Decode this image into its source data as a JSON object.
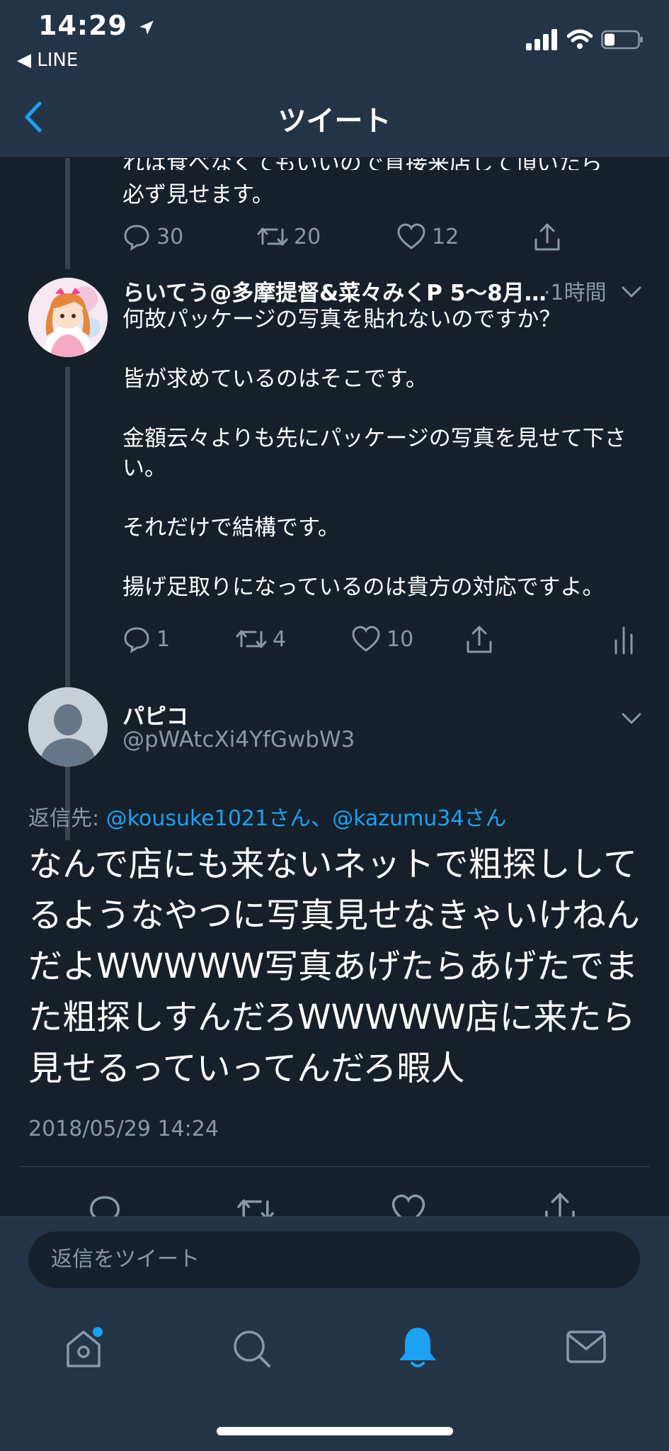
{
  "status_bar": {
    "time": "14:29",
    "back_app": "◀ LINE"
  },
  "header": {
    "title": "ツイート"
  },
  "prev_tweet": {
    "text_partial": "れは食べなくてもいいので直接来店して頂いたら",
    "text_tail": "必ず見せます。",
    "actions": {
      "reply": "30",
      "retweet": "20",
      "like": "12"
    }
  },
  "reply_tweet": {
    "name": "らいてう@多摩提督&菜々みくP 5〜8月…",
    "time": "·1時間",
    "paragraphs": [
      "何故パッケージの写真を貼れないのですか？",
      "皆が求めているのはそこです。",
      "金額云々よりも先にパッケージの写真を見せて下さい。",
      "それだけで結構です。",
      "揚げ足取りになっているのは貴方の対応ですよ。"
    ],
    "actions": {
      "reply": "1",
      "retweet": "4",
      "like": "10"
    }
  },
  "main_tweet": {
    "name": "パピコ",
    "handle": "@pWAtcXi4YfGwbW3",
    "reply_prefix": "返信先: ",
    "reply_to": "@kousuke1021さん、@kazumu34さん",
    "text": "なんで店にも来ないネットで粗探ししてるようなやつに写真見せなきゃいけねんだよWWWWW写真あげたらあげたでまた粗探しすんだろWWWWW店に来たら見せるっていってんだろ暇人",
    "timestamp": "2018/05/29 14:24"
  },
  "reply_bar": {
    "placeholder": "返信をツイート"
  },
  "tabs": [
    "home-icon",
    "search-icon",
    "notifications-icon",
    "messages-icon"
  ],
  "colors": {
    "accent": "#1da1f2",
    "background": "#15202b",
    "bar": "#243447",
    "muted": "#8899a6"
  }
}
